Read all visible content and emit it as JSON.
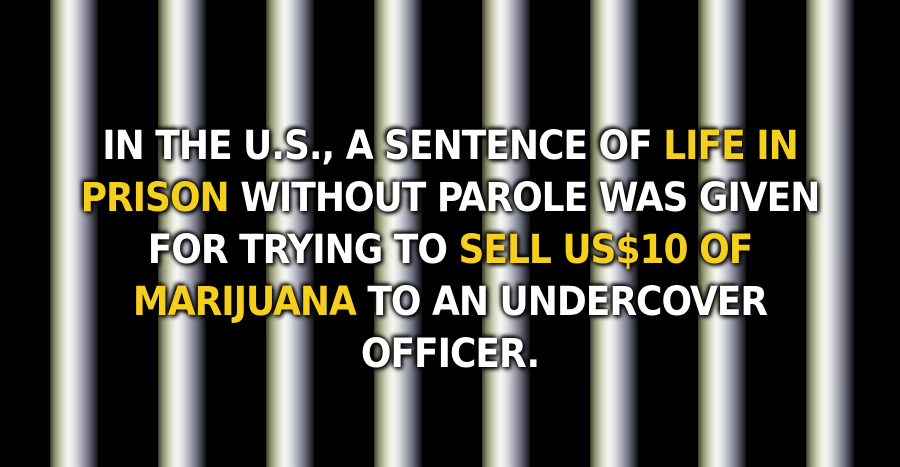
{
  "fact": {
    "part1": "In the U.S., a sentence of ",
    "highlight1": "life in prison",
    "part2": " without parole was given for trying to ",
    "highlight2": "sell US$10 of marijuana",
    "part3": " to an undercover officer."
  },
  "colors": {
    "background": "#000000",
    "text": "#ffffff",
    "highlight": "#f5cf1e"
  }
}
